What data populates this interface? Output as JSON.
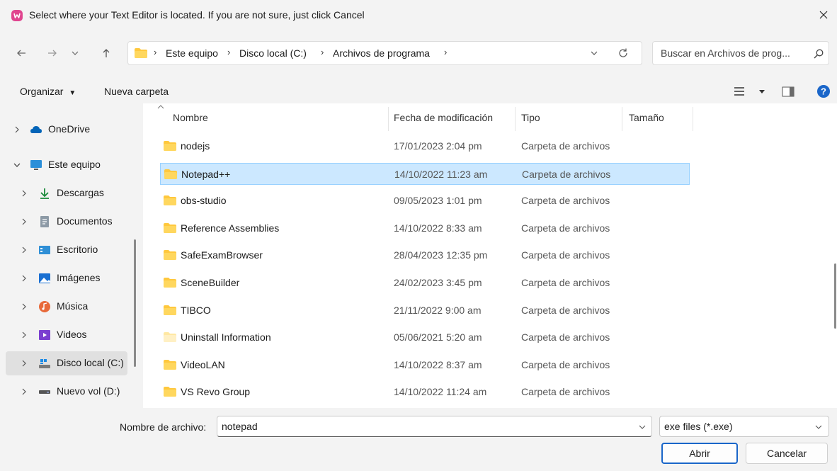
{
  "title": "Select where your Text Editor is located. If you are not sure, just click Cancel",
  "address": {
    "crumbs": [
      "Este equipo",
      "Disco local (C:)",
      "Archivos de programa"
    ]
  },
  "search": {
    "placeholder": "Buscar en Archivos de prog..."
  },
  "toolbar": {
    "organize_label": "Organizar",
    "new_folder_label": "Nueva carpeta"
  },
  "nav": {
    "items": [
      {
        "label": "OneDrive",
        "icon": "cloud-icon",
        "expanded": false
      },
      {
        "label": "Este equipo",
        "icon": "computer-icon",
        "expanded": true
      },
      {
        "label": "Descargas",
        "icon": "download-icon",
        "expanded": false
      },
      {
        "label": "Documentos",
        "icon": "document-icon",
        "expanded": false
      },
      {
        "label": "Escritorio",
        "icon": "desktop-icon",
        "expanded": false
      },
      {
        "label": "Imágenes",
        "icon": "pictures-icon",
        "expanded": false
      },
      {
        "label": "Música",
        "icon": "music-icon",
        "expanded": false
      },
      {
        "label": "Videos",
        "icon": "videos-icon",
        "expanded": false
      },
      {
        "label": "Disco local (C:)",
        "icon": "drive-icon",
        "expanded": false,
        "selected": true
      },
      {
        "label": "Nuevo vol (D:)",
        "icon": "drive-icon",
        "expanded": false
      }
    ]
  },
  "columns": {
    "name": "Nombre",
    "date": "Fecha de modificación",
    "type": "Tipo",
    "size": "Tamaño"
  },
  "files": [
    {
      "name": "nodejs",
      "date": "17/01/2023 2:04 pm",
      "type": "Carpeta de archivos"
    },
    {
      "name": "Notepad++",
      "date": "14/10/2022 11:23 am",
      "type": "Carpeta de archivos",
      "selected": true
    },
    {
      "name": "obs-studio",
      "date": "09/05/2023 1:01 pm",
      "type": "Carpeta de archivos"
    },
    {
      "name": "Reference Assemblies",
      "date": "14/10/2022 8:33 am",
      "type": "Carpeta de archivos"
    },
    {
      "name": "SafeExamBrowser",
      "date": "28/04/2023 12:35 pm",
      "type": "Carpeta de archivos"
    },
    {
      "name": "SceneBuilder",
      "date": "24/02/2023 3:45 pm",
      "type": "Carpeta de archivos"
    },
    {
      "name": "TIBCO",
      "date": "21/11/2022 9:00 am",
      "type": "Carpeta de archivos"
    },
    {
      "name": "Uninstall Information",
      "date": "05/06/2021 5:20 am",
      "type": "Carpeta de archivos",
      "hidden": true
    },
    {
      "name": "VideoLAN",
      "date": "14/10/2022 8:37 am",
      "type": "Carpeta de archivos"
    },
    {
      "name": "VS Revo Group",
      "date": "14/10/2022 11:24 am",
      "type": "Carpeta de archivos"
    }
  ],
  "footer": {
    "filename_label": "Nombre de archivo:",
    "filename_value": "notepad",
    "filetype_value": "exe files (*.exe)",
    "open_label": "Abrir",
    "cancel_label": "Cancelar"
  },
  "colors": {
    "selection_bg": "#cce8ff",
    "selection_border": "#99d1ff",
    "folder": "#ffc83d",
    "accent": "#1a66c9"
  }
}
